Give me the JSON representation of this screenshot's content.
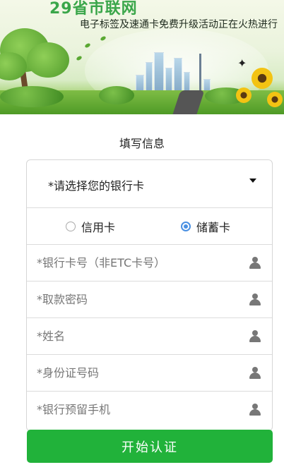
{
  "banner": {
    "title": "29省市联网",
    "subtitle": "电子标签及速通卡免费升级活动正在火热进行"
  },
  "form": {
    "heading": "填写信息",
    "bank_select_label": "*请选择您的银行卡",
    "card_types": [
      {
        "label": "信用卡",
        "checked": false
      },
      {
        "label": "储蓄卡",
        "checked": true
      }
    ],
    "fields": [
      {
        "placeholder": "*银行卡号（非ETC卡号）",
        "icon": "person-icon"
      },
      {
        "placeholder": "*取款密码",
        "icon": "person-icon"
      },
      {
        "placeholder": "*姓名",
        "icon": "person-icon"
      },
      {
        "placeholder": "*身份证号码",
        "icon": "person-icon"
      },
      {
        "placeholder": "*银行预留手机",
        "icon": "person-icon"
      }
    ],
    "submit_label": "开始认证"
  },
  "colors": {
    "accent_green": "#21b23a",
    "radio_blue": "#4a90e2"
  }
}
